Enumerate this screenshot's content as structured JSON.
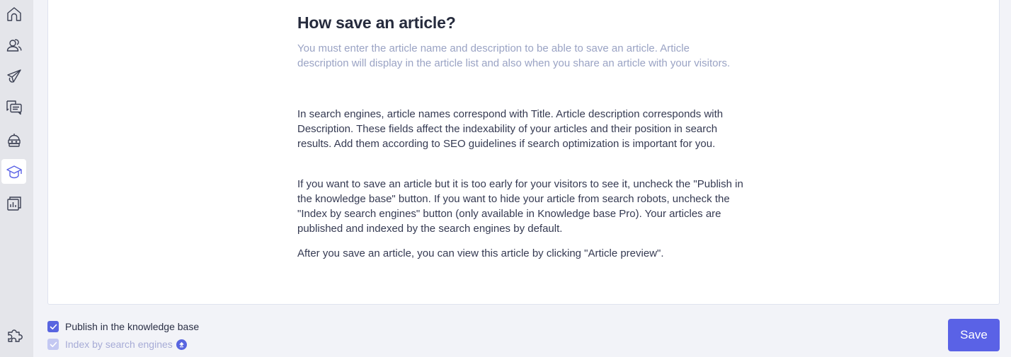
{
  "sidebar": {
    "items": [
      {
        "name": "home",
        "icon": "home-icon",
        "active": false
      },
      {
        "name": "contacts",
        "icon": "users-icon",
        "active": false
      },
      {
        "name": "campaigns",
        "icon": "paper-plane-icon",
        "active": false
      },
      {
        "name": "conversations",
        "icon": "chat-bubbles-icon",
        "active": false
      },
      {
        "name": "chatbot",
        "icon": "bot-icon",
        "active": false
      },
      {
        "name": "knowledge-base",
        "icon": "graduation-cap-icon",
        "active": true
      },
      {
        "name": "reports",
        "icon": "bar-chart-icon",
        "active": false
      }
    ],
    "bottom_item": {
      "name": "integrations",
      "icon": "puzzle-icon"
    }
  },
  "article": {
    "title": "How save an article?",
    "lead": "You must enter the article name and description to be able to save an article. Article description will display in the article list and also when you share an article with your visitors.",
    "paragraphs": [
      "In search engines, article names correspond with Title. Article description corresponds with Description. These fields affect the indexability of your articles and their position in search results. Add them according to SEO guidelines if search optimization is important for you.",
      "If you want to save an article but it is too early for your visitors to see it, uncheck the \"Publish in the knowledge base\" button. If you want to hide your article from search robots, uncheck the \"Index by search engines\" button (only available in Knowledge base Pro). Your articles are published and indexed by the search engines by default.",
      "After you save an article, you can view this article by clicking \"Article preview\"."
    ]
  },
  "footer": {
    "publish_label": "Publish in the knowledge base",
    "publish_checked": true,
    "index_label": "Index by search engines",
    "index_checked": true,
    "index_disabled": true,
    "pro_badge_icon": "upgrade-arrow-icon",
    "save_label": "Save"
  },
  "colors": {
    "accent": "#5a62e6",
    "sidebar_bg": "#e4e5ea",
    "page_bg": "#f2f3f8",
    "lead_text": "#9aa3c4"
  }
}
